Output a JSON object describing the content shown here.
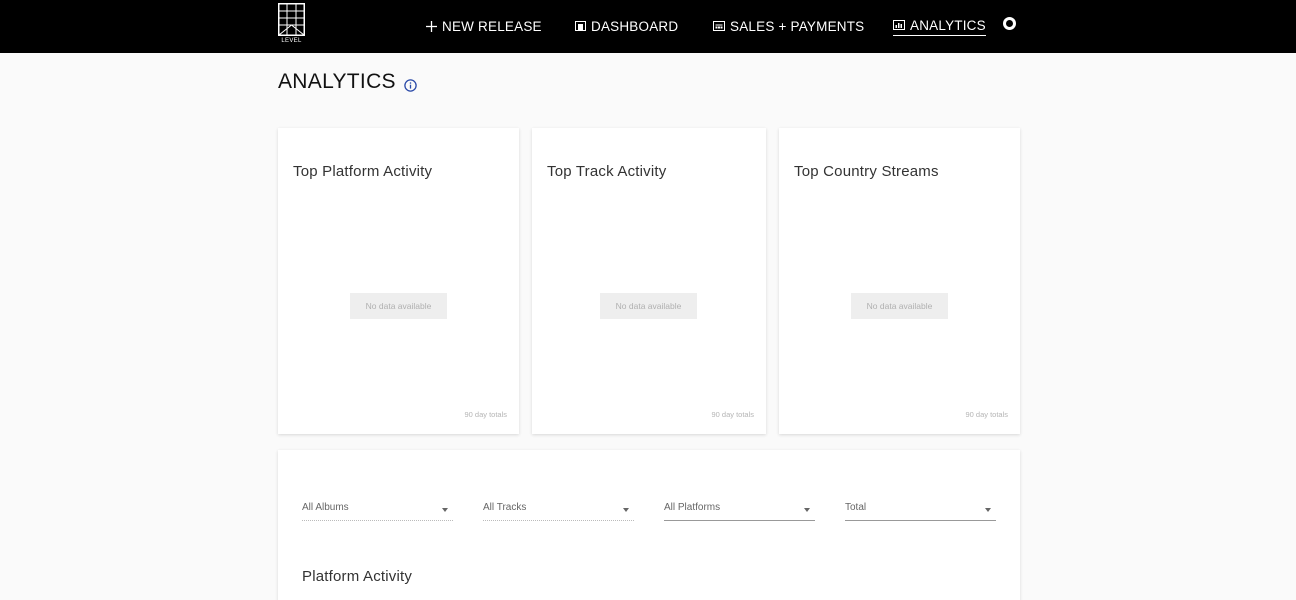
{
  "brand": {
    "logo_text": "LEVEL"
  },
  "nav": {
    "new_release": "NEW RELEASE",
    "dashboard": "DASHBOARD",
    "sales": "SALES + PAYMENTS",
    "analytics": "ANALYTICS",
    "active": "ANALYTICS"
  },
  "page": {
    "title": "ANALYTICS"
  },
  "cards": [
    {
      "title": "Top Platform Activity",
      "empty": "No data available",
      "footer": "90 day totals"
    },
    {
      "title": "Top Track Activity",
      "empty": "No data available",
      "footer": "90 day totals"
    },
    {
      "title": "Top Country Streams",
      "empty": "No data available",
      "footer": "90 day totals"
    }
  ],
  "filters": {
    "album": "All Albums",
    "track": "All Tracks",
    "platform": "All Platforms",
    "metric": "Total"
  },
  "panel": {
    "title": "Platform Activity"
  },
  "colors": {
    "topbar": "#000000",
    "info_icon": "#2b4aa8",
    "background": "#fafafa"
  },
  "icons": [
    "plus-icon",
    "dashboard-icon",
    "sales-icon",
    "analytics-icon",
    "account-icon",
    "info-icon",
    "dropdown-caret-icon"
  ]
}
